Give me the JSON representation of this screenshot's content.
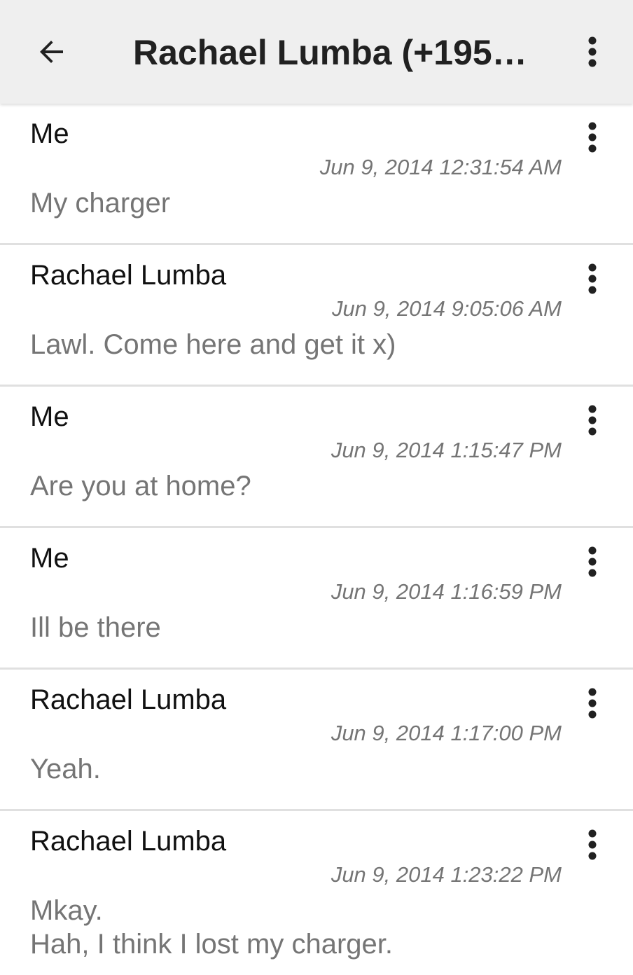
{
  "appbar": {
    "title": "Rachael Lumba (+195…",
    "back_icon": "arrow-back-icon",
    "menu_icon": "more-vert-icon"
  },
  "messages": [
    {
      "sender": "Me",
      "timestamp": "Jun 9, 2014 12:31:54 AM",
      "text": "My charger"
    },
    {
      "sender": "Rachael Lumba",
      "timestamp": "Jun 9, 2014 9:05:06 AM",
      "text": "Lawl. Come here and get it x)"
    },
    {
      "sender": "Me",
      "timestamp": "Jun 9, 2014 1:15:47 PM",
      "text": "Are you at home?"
    },
    {
      "sender": "Me",
      "timestamp": "Jun 9, 2014 1:16:59 PM",
      "text": "Ill be there"
    },
    {
      "sender": "Rachael Lumba",
      "timestamp": "Jun 9, 2014 1:17:00 PM",
      "text": "Yeah."
    },
    {
      "sender": "Rachael Lumba",
      "timestamp": "Jun 9, 2014 1:23:22 PM",
      "text": "Mkay.\nHah, I think I lost my charger."
    }
  ],
  "colors": {
    "appbar_bg": "#efefef",
    "sender_text": "#111111",
    "secondary_text": "#757575",
    "divider": "#e0e0e0"
  }
}
